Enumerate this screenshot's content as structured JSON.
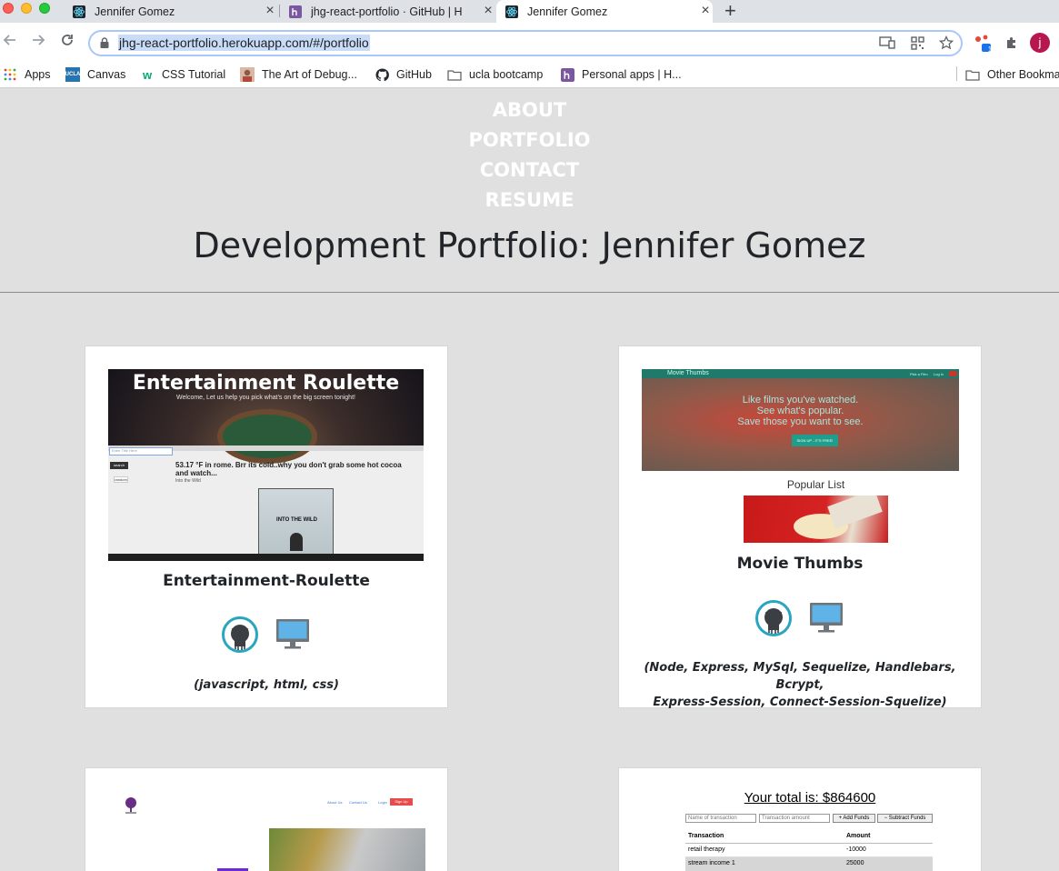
{
  "browser": {
    "tabs": [
      {
        "title": "Jennifer Gomez",
        "favicon": "react-icon"
      },
      {
        "title": "jhg-react-portfolio · GitHub | H",
        "favicon": "heroku-icon"
      },
      {
        "title": "Jennifer Gomez",
        "favicon": "react-icon",
        "active": true
      }
    ],
    "new_tab": "+",
    "url": "jhg-react-portfolio.herokuapp.com/#/portfolio",
    "avatar_initial": "j",
    "extension_badge": "1",
    "bookmarks": [
      {
        "label": "Apps",
        "icon": "apps-grid-icon"
      },
      {
        "label": "Canvas",
        "icon": "ucla-icon"
      },
      {
        "label": "CSS Tutorial",
        "icon": "w3schools-icon"
      },
      {
        "label": "The Art of Debug...",
        "icon": "portrait-icon"
      },
      {
        "label": "GitHub",
        "icon": "github-icon"
      },
      {
        "label": "ucla bootcamp",
        "icon": "folder-icon"
      },
      {
        "label": "Personal apps | H...",
        "icon": "heroku-icon"
      }
    ],
    "other_bookmarks": "Other Bookma"
  },
  "nav": {
    "about": "ABOUT",
    "portfolio": "PORTFOLIO",
    "contact": "CONTACT",
    "resume": "RESUME"
  },
  "page_title": "Development Portfolio: Jennifer Gomez",
  "projects": [
    {
      "title": "Entertainment-Roulette",
      "tech": "(javascript, html, css)",
      "shot": {
        "header": "Entertainment Roulette",
        "subheader": "Welcome, Let us help you pick what's on the big screen tonight!",
        "search_placeholder": "Enter Title Here",
        "search_btn": "search",
        "random_btn": "random",
        "weather": "53.17 °F in rome. Brr its cold..why you don't grab some hot cocoa and watch...",
        "movie": "Into the Wild",
        "poster_title": "INTO THE WILD"
      }
    },
    {
      "title": "Movie Thumbs",
      "tech_line1": "(Node, Express, MySql, Sequelize, Handlebars, Bcrypt,",
      "tech_line2": "Express-Session, Connect-Session-Squelize)",
      "shot": {
        "brand": "Movie Thumbs",
        "nav1": "Pick a Film",
        "nav2": "Log in",
        "line1": "Like films you've watched.",
        "line2": "See what's popular.",
        "line3": "Save those you want to see.",
        "cta": "SIGN UP - IT'S FREE!",
        "popular": "Popular List"
      }
    },
    {
      "shot": {
        "nav1": "About Us",
        "nav2": "Contact Us",
        "nav3": "Login",
        "nav4": "Sign Up"
      }
    },
    {
      "shot": {
        "total": "Your total is: $864600",
        "name_placeholder": "Name of transaction",
        "amount_placeholder": "Transaction amount",
        "add": "+ Add Funds",
        "subtract": "− Subtract Funds",
        "col1": "Transaction",
        "col2": "Amount",
        "rows": [
          {
            "name": "retail therapy",
            "amount": "-10000"
          },
          {
            "name": "stream income 1",
            "amount": "25000"
          }
        ]
      }
    }
  ]
}
